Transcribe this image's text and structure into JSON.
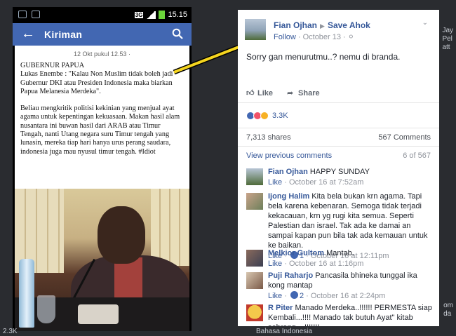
{
  "phone": {
    "status": {
      "network": "3G",
      "time": "15.15"
    },
    "appbar": {
      "back_icon": "arrow-left-icon",
      "title": "Kiriman",
      "search_icon": "search-icon"
    },
    "post": {
      "date": "12 Okt pukul 12.53 · ",
      "paragraphs": [
        "GUBERNUR PAPUA\nLukas Enembe : \"Kalau Non Muslim tidak boleh jadi Gubernur DKI atau Presiden Indonesia maka biarkan Papua Melanesia Merdeka\".",
        "Beliau mengkritik politisi kekinian yang menjual ayat agama untuk kepentingan kekuasaan. Makan hasil alam nusantara ini buwan hasil dari ARAB atau Timur Tengah, nanti Utang negara suru Timur tengah yang lunasin, mereka tiap hari hanya urus perang saudara, indonesia juga mau nyusul timur tengah. #Idiot"
      ]
    }
  },
  "card": {
    "author": "Fian Ojhan",
    "target": "Save Ahok",
    "follow": "Follow",
    "date": "October 13",
    "text": "Sorry gan menurutmu..? nemu di branda.",
    "like": "Like",
    "share": "Share",
    "reactions": "3.3K",
    "shares": "7,313 shares",
    "comments_count": "567 Comments",
    "view_prev": "View previous comments",
    "pager": "6 of 567",
    "comments": [
      {
        "name": "Fian Ojhan",
        "text": "HAPPY SUNDAY",
        "like": "Like",
        "time": "October 16 at 7:52am",
        "likes": ""
      },
      {
        "name": "Ijong Halim",
        "text": "Kita bela bukan krn agama. Tapi bela karena kebenaran. Semoga tidak terjadi kekacauan, krn yg rugi kita semua. Seperti Palestian dan israel. Tak ada ke damai an sampai kapan pun bila tak ada kemauan untuk ke baikan.",
        "like": "Like",
        "time": "October 16 at 12:11pm",
        "likes": "1"
      },
      {
        "name": "Melkior Gultom",
        "text": "Mantab.",
        "like": "Like",
        "time": "October 16 at 1:16pm",
        "likes": ""
      },
      {
        "name": "Puji Raharjo",
        "text": "Pancasila bhineka tunggal ika kong mantap",
        "like": "Like",
        "time": "October 16 at 2:24pm",
        "likes": "2"
      },
      {
        "name": "R Piter",
        "text": "Manado Merdeka..!!!!!! PERMESTA siap Kembali...!!!! Manado tak butuh Ayat\" kitab sebrang....!!!!!!!",
        "like": "",
        "time": "",
        "likes": ""
      }
    ]
  },
  "edges": {
    "right_top": "Jay\nPel\natt",
    "right_mid": "om\nda",
    "bottom": "Bahasa Indonesia",
    "bottom_left": "2.3K"
  },
  "colors": {
    "facebook_blue": "#4267b2",
    "link_blue": "#365899",
    "arrow_yellow": "#f5d51f"
  }
}
